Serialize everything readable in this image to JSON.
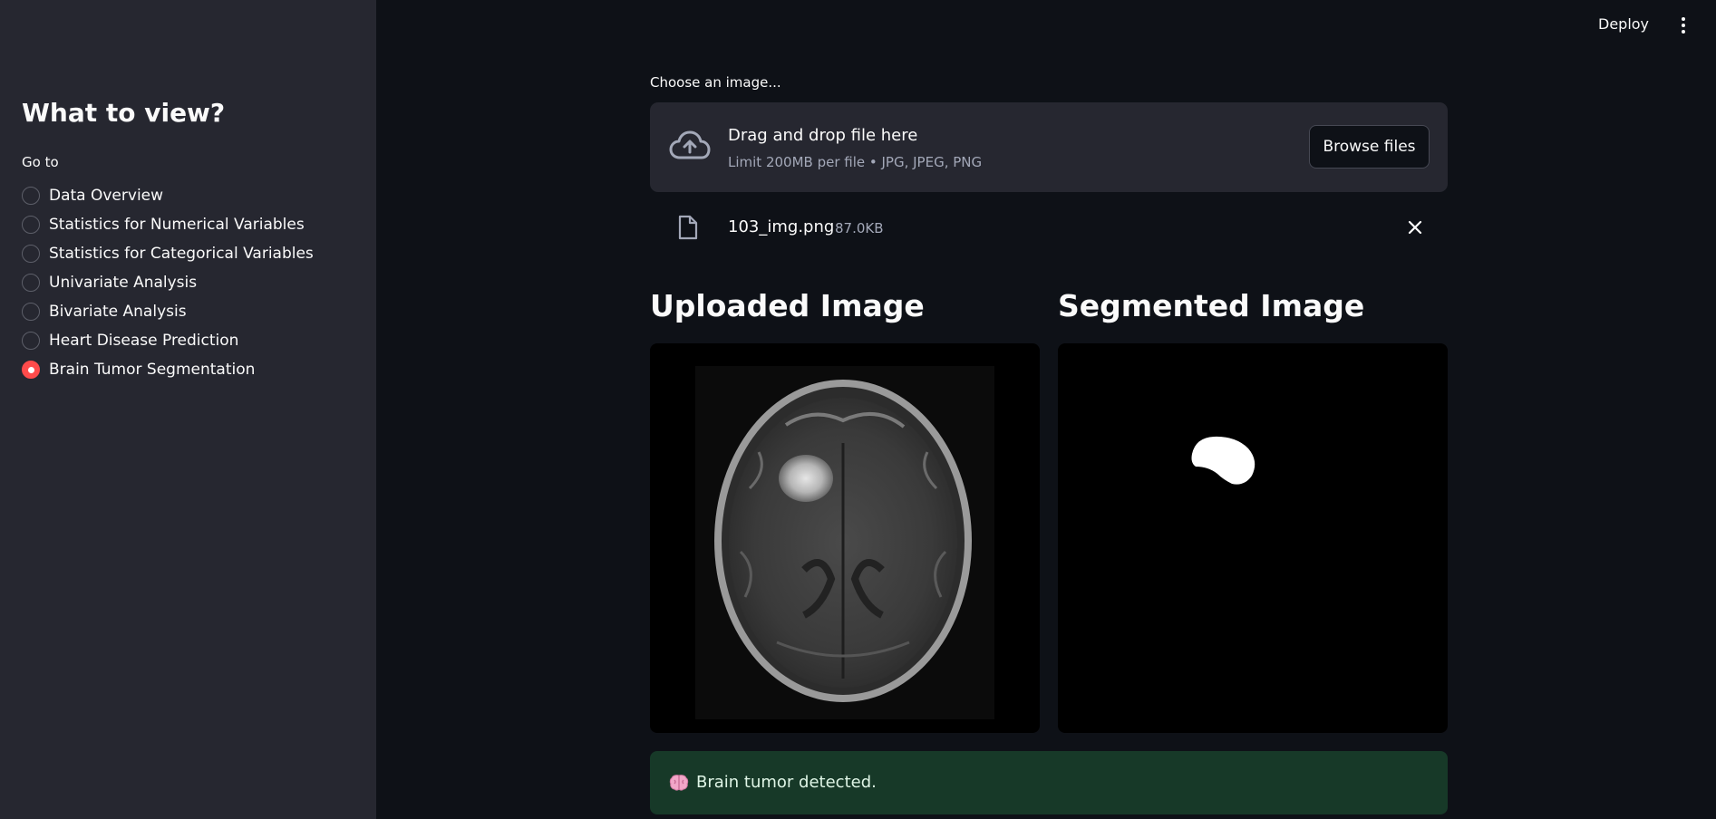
{
  "header": {
    "deploy_label": "Deploy",
    "menu_icon": "kebab-menu-icon"
  },
  "sidebar": {
    "title": "What to view?",
    "radio_label": "Go to",
    "options": [
      {
        "label": "Data Overview",
        "selected": false
      },
      {
        "label": "Statistics for Numerical Variables",
        "selected": false
      },
      {
        "label": "Statistics for Categorical Variables",
        "selected": false
      },
      {
        "label": "Univariate Analysis",
        "selected": false
      },
      {
        "label": "Bivariate Analysis",
        "selected": false
      },
      {
        "label": "Heart Disease Prediction",
        "selected": false
      },
      {
        "label": "Brain Tumor Segmentation",
        "selected": true
      }
    ],
    "accent_color": "#ff4b4b"
  },
  "uploader": {
    "label": "Choose an image...",
    "drop_title": "Drag and drop file here",
    "drop_subtitle": "Limit 200MB per file • JPG, JPEG, PNG",
    "browse_label": "Browse files",
    "icon": "cloud-upload-icon"
  },
  "file": {
    "name": "103_img.png",
    "size": "87.0KB",
    "icon": "file-icon"
  },
  "images": {
    "uploaded_title": "Uploaded Image",
    "segmented_title": "Segmented Image"
  },
  "result": {
    "icon": "brain-icon",
    "message": "Brain tumor detected.",
    "color": "#173928"
  }
}
